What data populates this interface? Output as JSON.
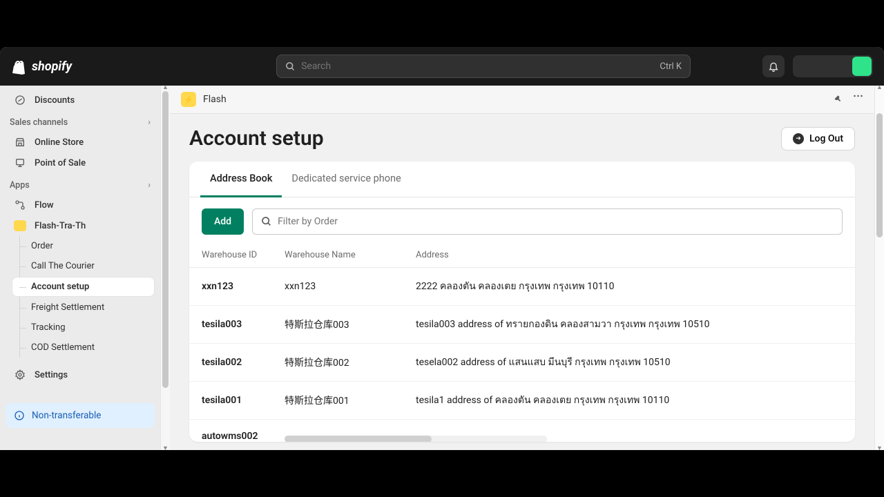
{
  "brand": "shopify",
  "search": {
    "placeholder": "Search",
    "kbd": "Ctrl K"
  },
  "sidebar": {
    "discounts": "Discounts",
    "salesChannels": "Sales channels",
    "onlineStore": "Online Store",
    "pos": "Point of Sale",
    "apps": "Apps",
    "flow": "Flow",
    "flashApp": "Flash-Tra-Th",
    "sub": {
      "order": "Order",
      "call": "Call The Courier",
      "account": "Account setup",
      "freight": "Freight Settlement",
      "tracking": "Tracking",
      "cod": "COD Settlement"
    },
    "settings": "Settings",
    "nonTransferable": "Non-transferable"
  },
  "appHeader": {
    "title": "Flash"
  },
  "page": {
    "title": "Account setup",
    "logout": "Log Out",
    "tabs": {
      "addressBook": "Address Book",
      "dedicated": "Dedicated service phone"
    },
    "addBtn": "Add",
    "filterPlaceholder": "Filter by Order",
    "columns": {
      "id": "Warehouse ID",
      "name": "Warehouse Name",
      "addr": "Address"
    },
    "rows": [
      {
        "id": "xxn123",
        "name": "xxn123",
        "addr": "2222 คลองตัน คลองเตย กรุงเทพ กรุงเทพ 10110"
      },
      {
        "id": "tesila003",
        "name": "特斯拉仓库003",
        "addr": "tesila003 address of ทรายกองดิน คลองสามวา กรุงเทพ กรุงเทพ 10510"
      },
      {
        "id": "tesila002",
        "name": "特斯拉仓库002",
        "addr": "tesela002 address of แสนแสบ มีนบุรี กรุงเทพ กรุงเทพ 10510"
      },
      {
        "id": "tesila001",
        "name": "特斯拉仓库001",
        "addr": "tesila1 address of คลองตัน คลองเตย กรุงเทพ กรุงเทพ 10110"
      },
      {
        "id": "autowms002",
        "name": "",
        "addr": ""
      }
    ]
  }
}
